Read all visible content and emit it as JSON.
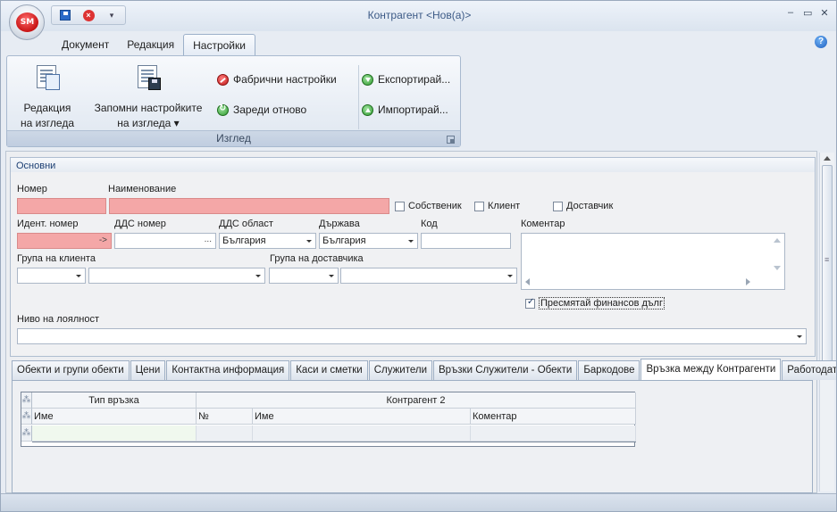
{
  "window": {
    "title": "Контрагент <Нов(а)>",
    "orb_label": "SM",
    "controls": [
      "–",
      "▭",
      "✕"
    ]
  },
  "ribbon": {
    "tabs": [
      "Документ",
      "Редакция",
      "Настройки"
    ],
    "active_tab": "Настройки",
    "group_label": "Изглед",
    "buttons": {
      "edit_view": [
        "Редакция",
        "на изгледа"
      ],
      "save_view": [
        "Запомни настройките",
        "на изгледа ▾"
      ],
      "factory": "Фабрични настройки",
      "reload": "Зареди отново",
      "export": "Експортирай...",
      "import": "Импортирай..."
    }
  },
  "section": {
    "title": "Основни",
    "labels": {
      "number": "Номер",
      "name": "Наименование",
      "owner": "Собственик",
      "client": "Клиент",
      "supplier": "Доставчик",
      "ident": "Идент. номер",
      "vat_number": "ДДС номер",
      "vat_region": "ДДС област",
      "country": "Държава",
      "code": "Код",
      "comment": "Коментар",
      "client_group": "Група на клиента",
      "supplier_group": "Група на доставчика",
      "loyalty": "Ниво на лоялност",
      "calc_debt": "Пресмятай финансов дълг"
    },
    "values": {
      "ident_suffix": "->",
      "vat_number_ellipsis": "...",
      "vat_region": "България",
      "country": "България"
    },
    "checks": {
      "owner": false,
      "client": false,
      "supplier": false,
      "calc_debt": true
    }
  },
  "tabs": [
    "Обекти и групи обекти",
    "Цени",
    "Контактна информация",
    "Каси и сметки",
    "Служители",
    "Връзки Служители - Обекти",
    "Баркодове",
    "Връзка между Контрагенти",
    "Работодатели"
  ],
  "active_tab_index": 7,
  "grid": {
    "band_1": "Тип връзка",
    "band_2": "Контрагент 2",
    "columns": [
      "Име",
      "№",
      "Име",
      "Коментар"
    ],
    "indicator": "⁂"
  }
}
